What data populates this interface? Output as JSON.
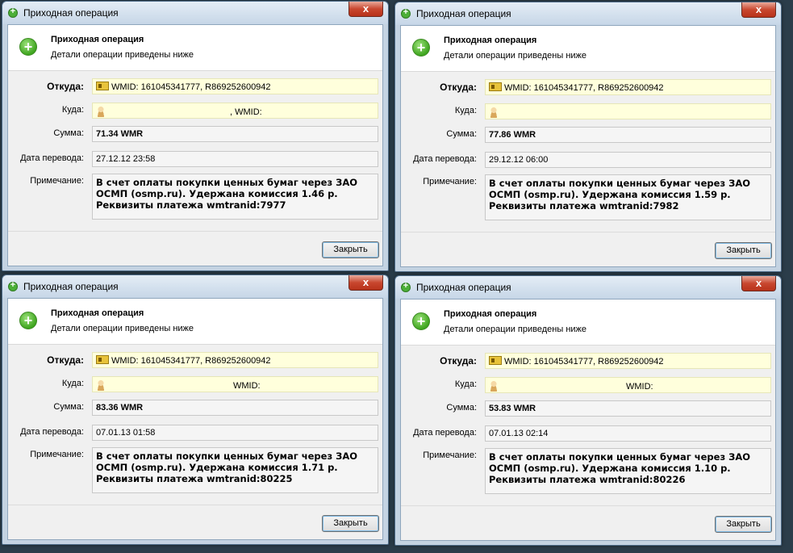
{
  "windows": [
    {
      "title": "Приходная операция",
      "close_glyph": "x",
      "header_title": "Приходная операция",
      "header_subtitle": "Детали операции приведены ниже",
      "labels": {
        "from": "Откуда:",
        "to": "Куда:",
        "amount": "Сумма:",
        "date": "Дата перевода:",
        "note": "Примечание:"
      },
      "from_value": "WMID: 161045341777, R869252600942",
      "to_value": ", WMID:",
      "amount": "71.34 WMR",
      "date": "27.12.12 23:58",
      "note": "В счет оплаты покупки ценных бумаг через ЗАО ОСМП (osmp.ru). Удержана комиссия 1.46 р. Реквизиты платежа wmtranid:7977",
      "button": "Закрыть"
    },
    {
      "title": "Приходная операция",
      "close_glyph": "x",
      "header_title": "Приходная операция",
      "header_subtitle": "Детали операции приведены ниже",
      "labels": {
        "from": "Откуда:",
        "to": "Куда:",
        "amount": "Сумма:",
        "date": "Дата перевода:",
        "note": "Примечание:"
      },
      "from_value": "WMID: 161045341777, R869252600942",
      "to_value": "",
      "amount": "77.86 WMR",
      "date": "29.12.12 06:00",
      "note": "В счет оплаты покупки ценных бумаг через ЗАО ОСМП (osmp.ru). Удержана комиссия 1.59 р. Реквизиты платежа wmtranid:7982",
      "button": "Закрыть"
    },
    {
      "title": "Приходная операция",
      "close_glyph": "x",
      "header_title": "Приходная операция",
      "header_subtitle": "Детали операции приведены ниже",
      "labels": {
        "from": "Откуда:",
        "to": "Куда:",
        "amount": "Сумма:",
        "date": "Дата перевода:",
        "note": "Примечание:"
      },
      "from_value": "WMID: 161045341777, R869252600942",
      "to_value": "WMID:",
      "amount": "83.36 WMR",
      "date": "07.01.13 01:58",
      "note": "В счет оплаты покупки ценных бумаг через ЗАО ОСМП (osmp.ru). Удержана комиссия 1.71 р. Реквизиты платежа wmtranid:80225",
      "button": "Закрыть"
    },
    {
      "title": "Приходная операция",
      "close_glyph": "x",
      "header_title": "Приходная операция",
      "header_subtitle": "Детали операции приведены ниже",
      "labels": {
        "from": "Откуда:",
        "to": "Куда:",
        "amount": "Сумма:",
        "date": "Дата перевода:",
        "note": "Примечание:"
      },
      "from_value": "WMID: 161045341777, R869252600942",
      "to_value": "WMID:",
      "amount": "53.83 WMR",
      "date": "07.01.13 02:14",
      "note": "В счет оплаты покупки ценных бумаг через ЗАО ОСМП (osmp.ru). Удержана комиссия 1.10 р. Реквизиты платежа wmtranid:80226",
      "button": "Закрыть"
    }
  ],
  "icons": {
    "title": "plus-circle-icon",
    "header": "plus-circle-icon",
    "from": "wm-passport-icon",
    "to": "user-icon"
  },
  "colors": {
    "accent_green": "#4caf38",
    "close_red": "#c8472f",
    "highlight_field": "#ffffdc"
  }
}
